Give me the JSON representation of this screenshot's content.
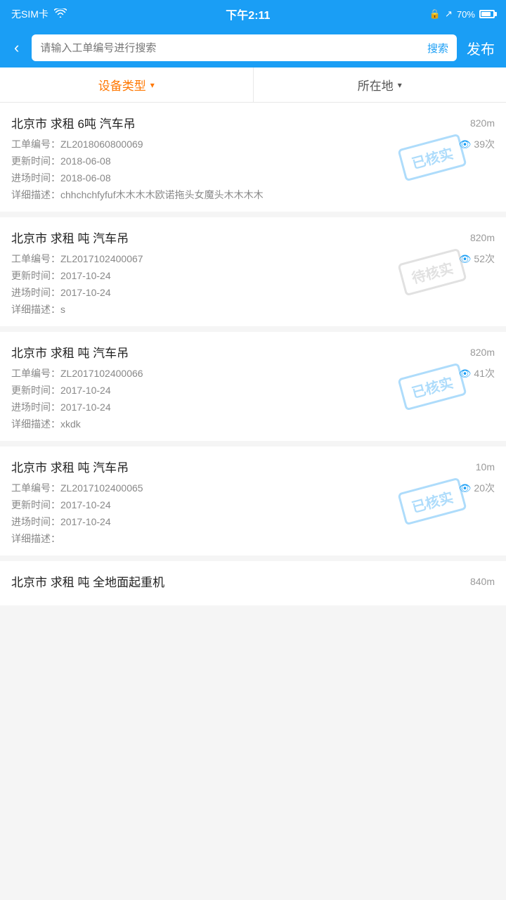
{
  "statusBar": {
    "signal": "无SIM卡",
    "wifi": "WiFi",
    "time": "下午2:11",
    "lock": "🔒",
    "location": "↗",
    "battery": "70%"
  },
  "header": {
    "back": "‹",
    "searchPlaceholder": "请输入工单编号进行搜索",
    "searchBtn": "搜索",
    "publishBtn": "发布"
  },
  "filters": [
    {
      "label": "设备类型",
      "active": true
    },
    {
      "label": "所在地",
      "active": false
    }
  ],
  "items": [
    {
      "title": "北京市 求租 6吨 汽车吊",
      "distance": "820m",
      "orderNo": "工单编号：ZL2018060800069",
      "views": "39次",
      "updateTime": "更新时间：2018-06-08",
      "entryTime": "进场时间：2018-06-08",
      "desc": "详细描述：chhchchfyfuf木木木木欧诺拖头女魔头木木木木",
      "stamp": "已核实",
      "stampType": "sold"
    },
    {
      "title": "北京市 求租 吨 汽车吊",
      "distance": "820m",
      "orderNo": "工单编号：ZL2017102400067",
      "views": "52次",
      "updateTime": "更新时间：2017-10-24",
      "entryTime": "进场时间：2017-10-24",
      "desc": "详细描述：s",
      "stamp": "待核实",
      "stampType": "pending"
    },
    {
      "title": "北京市 求租 吨 汽车吊",
      "distance": "820m",
      "orderNo": "工单编号：ZL2017102400066",
      "views": "41次",
      "updateTime": "更新时间：2017-10-24",
      "entryTime": "进场时间：2017-10-24",
      "desc": "详细描述：xkdk",
      "stamp": "已核实",
      "stampType": "sold"
    },
    {
      "title": "北京市 求租 吨 汽车吊",
      "distance": "10m",
      "orderNo": "工单编号：ZL2017102400065",
      "views": "20次",
      "updateTime": "更新时间：2017-10-24",
      "entryTime": "进场时间：2017-10-24",
      "desc": "详细描述：",
      "stamp": "已核实",
      "stampType": "sold"
    },
    {
      "title": "北京市 求租 吨 全地面起重机",
      "distance": "840m",
      "orderNo": "",
      "views": "",
      "updateTime": "",
      "entryTime": "",
      "desc": "",
      "stamp": "",
      "stampType": ""
    }
  ]
}
